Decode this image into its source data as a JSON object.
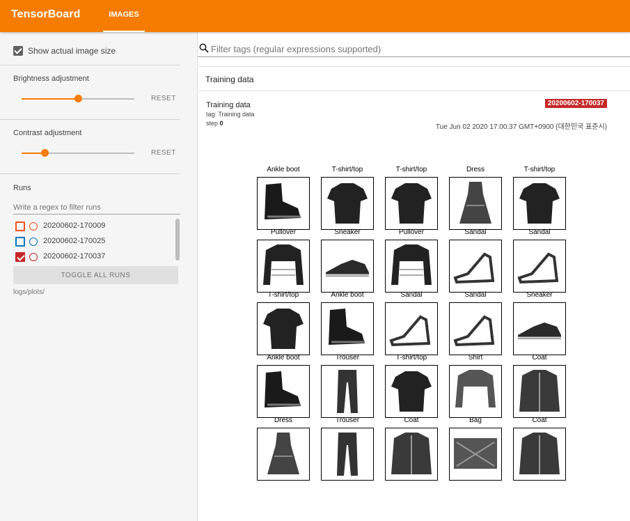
{
  "app": {
    "brand": "TensorBoard",
    "active_tab": "IMAGES"
  },
  "sidebar": {
    "show_actual_size": {
      "label": "Show actual image size",
      "checked": true
    },
    "brightness": {
      "label": "Brightness adjustment",
      "value": 0.55,
      "reset_label": "RESET"
    },
    "contrast": {
      "label": "Contrast adjustment",
      "value": 0.2,
      "reset_label": "RESET"
    },
    "runs": {
      "title": "Runs",
      "filter_placeholder": "Write a regex to filter runs",
      "items": [
        {
          "name": "20200602-170009",
          "color": "#f4511e",
          "checked": false
        },
        {
          "name": "20200602-170025",
          "color": "#0277bd",
          "checked": false
        },
        {
          "name": "20200602-170037",
          "color": "#c62828",
          "checked": true
        }
      ],
      "toggle_label": "TOGGLE ALL RUNS",
      "logdir": "logs/plots/"
    }
  },
  "main": {
    "search_placeholder": "Filter tags (regular expressions supported)",
    "card_title": "Training data",
    "image_card": {
      "name": "Training data",
      "tag": "tag: Training data",
      "step_label": "step",
      "step_value": "0",
      "run_badge": "20200602-170037",
      "timestamp": "Tue Jun 02 2020 17:00:37 GMT+0900 (대한민국 표준시)"
    },
    "grid_labels": [
      [
        "Ankle boot",
        "T-shirt/top",
        "T-shirt/top",
        "Dress",
        "T-shirt/top"
      ],
      [
        "Pullover",
        "Sneaker",
        "Pullover",
        "Sandal",
        "Sandal"
      ],
      [
        "T-shirt/top",
        "Ankle boot",
        "Sandal",
        "Sandal",
        "Sneaker"
      ],
      [
        "Ankle boot",
        "Trouser",
        "T-shirt/top",
        "Shirt",
        "Coat"
      ],
      [
        "Dress",
        "Trouser",
        "Coat",
        "Bag",
        "Coat"
      ]
    ]
  }
}
